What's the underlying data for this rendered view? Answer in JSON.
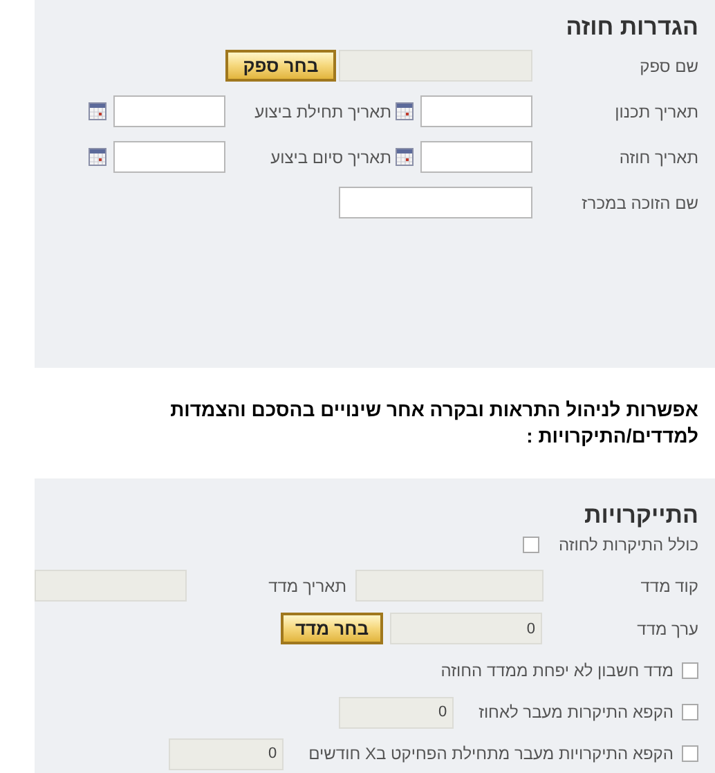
{
  "contract_settings": {
    "title": "הגדרות חוזה",
    "supplier": {
      "label": "שם ספק",
      "button": "בחר ספק"
    },
    "date_rows": [
      {
        "label": "תאריך תכנון",
        "label_2": "תאריך תחילת ביצוע"
      },
      {
        "label": "תאריך חוזה",
        "label_2": "תאריך סיום ביצוע"
      }
    ],
    "tender_winner": {
      "label": "שם הזוכה במכרז"
    }
  },
  "note": "אפשרות לניהול התראות ובקרה אחר שינויים בהסכם והצמדות למדדים/התיקרויות :",
  "indexation": {
    "title": "התייקרויות",
    "include": {
      "label": "כולל התיקרות לחוזה",
      "checked": false
    },
    "index_code": {
      "label": "קוד מדד",
      "label_2": "תאריך מדד"
    },
    "index_value": {
      "label": "ערך מדד",
      "value": "0",
      "button": "בחר מדד"
    },
    "options": [
      {
        "label": "מדד חשבון לא יפחת ממדד החוזה",
        "checked": false
      },
      {
        "label": "הקפא התיקרות מעבר לאחוז",
        "checked": false,
        "value": "0"
      },
      {
        "label": "הקפא התיקרויות מעבר מתחילת הפחיקט בX חודשים",
        "checked": false,
        "value": "0"
      }
    ]
  }
}
